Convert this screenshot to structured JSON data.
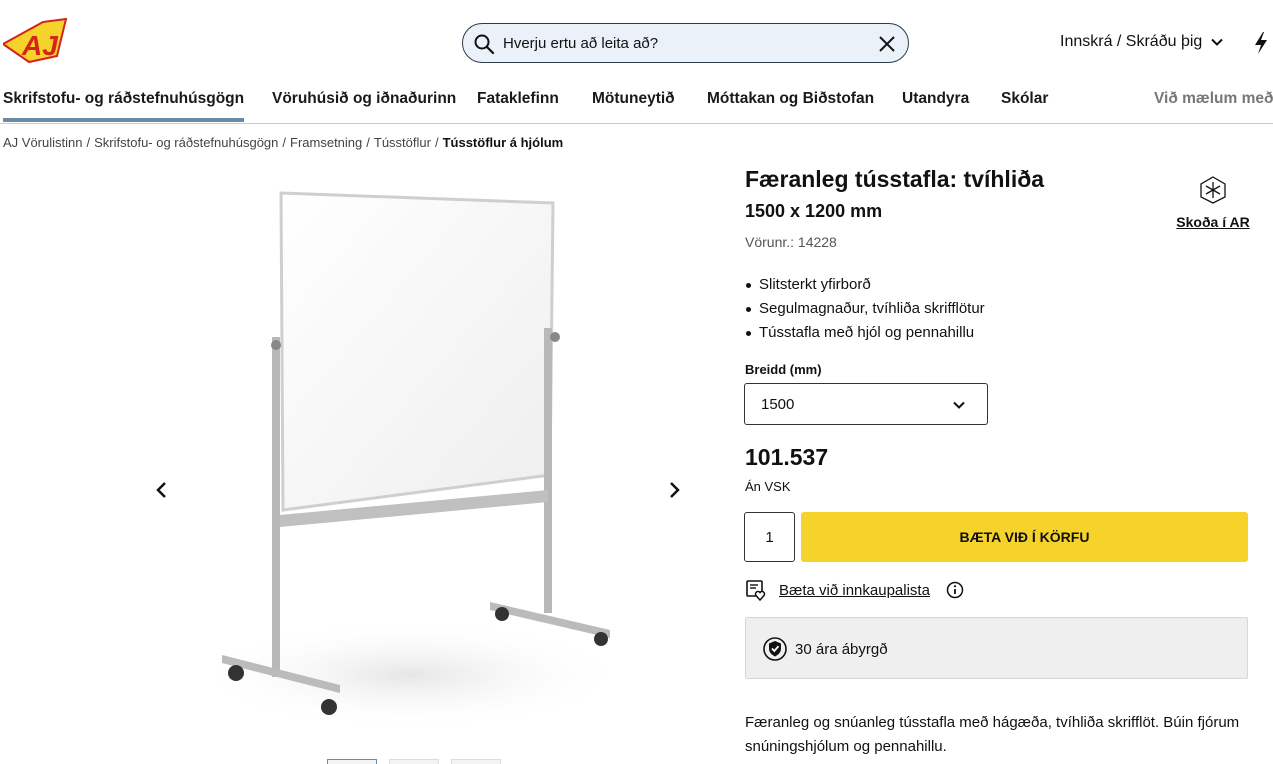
{
  "brand": {
    "logo_text": "AJ",
    "accent": "#f6d32b",
    "logo_red": "#d6231c"
  },
  "header": {
    "search_placeholder": "Hverju ertu að leita að?",
    "login_label": "Innskrá / Skráðu þig",
    "icons": [
      "search-icon",
      "close-icon",
      "chevron-down-icon",
      "lightning-icon"
    ]
  },
  "nav": {
    "items": [
      {
        "label": "Skrifstofu- og ráðstefnuhúsgögn"
      },
      {
        "label": "Vöruhúsið og iðnaðurinn"
      },
      {
        "label": "Fataklefinn"
      },
      {
        "label": "Mötuneytið"
      },
      {
        "label": "Móttakan og Biðstofan"
      },
      {
        "label": "Utandyra"
      },
      {
        "label": "Skólar"
      },
      {
        "label": "Við mælum með"
      }
    ]
  },
  "breadcrumb": {
    "items": [
      {
        "label": "AJ Vörulistinn"
      },
      {
        "label": "Skrifstofu- og ráðstefnuhúsgögn"
      },
      {
        "label": "Framsetning"
      },
      {
        "label": "Tússtöflur"
      },
      {
        "label": "Tússtöflur á hjólum"
      }
    ]
  },
  "product": {
    "title": "Færanleg tússtafla: tvíhliða",
    "size": "1500 x 1200 mm",
    "sku": "Vörunr.: 14228",
    "ar_label": "Skoða í AR",
    "bullets": [
      "Slitsterkt yfirborð",
      "Segulmagnaður, tvíhliða skrifflötur",
      "Tússtafla með hjól og pennahillu"
    ],
    "width_label": "Breidd (mm)",
    "width_value": "1500",
    "price": "101.537",
    "vat_note": "Án VSK",
    "quantity": "1",
    "add_to_cart": "BÆTA VIÐ Í KÖRFU",
    "wishlist_label": "Bæta við innkaupalista",
    "warranty": "30 ára ábyrgð",
    "description": "Færanleg og snúanleg tússtafla með hágæða, tvíhliða skrifflöt. Búin fjórum snúningshjólum og pennahillu."
  },
  "gallery": {
    "thumb_count": 3,
    "active_thumb": 1
  }
}
